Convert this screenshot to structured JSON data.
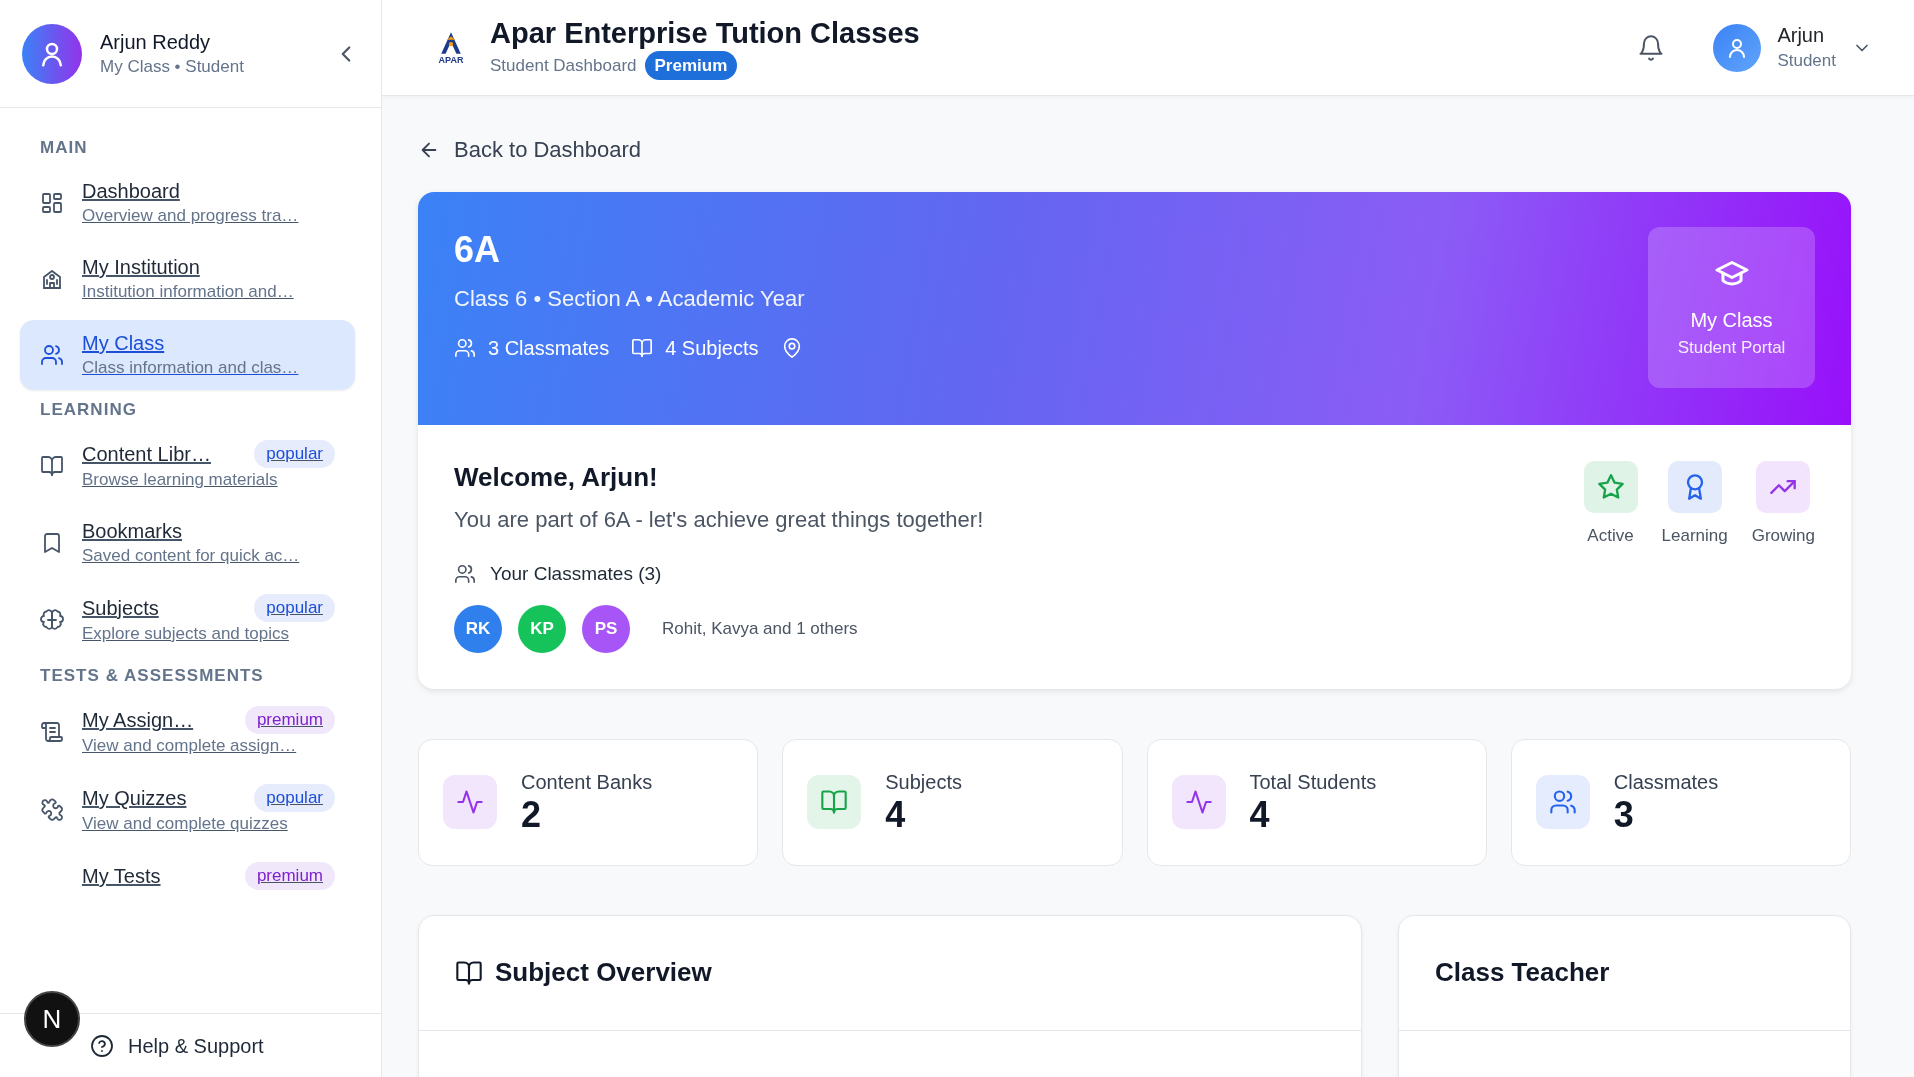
{
  "sidebar": {
    "user": {
      "name": "Arjun Reddy",
      "subtitle": "My Class • Student"
    },
    "sections": [
      {
        "label": "MAIN",
        "items": [
          {
            "kind": "grid",
            "title": "Dashboard",
            "description": "Overview and progress tra…",
            "selected": false
          },
          {
            "kind": "building",
            "title": "My Institution",
            "description": "Institution information and…",
            "selected": false
          },
          {
            "kind": "users",
            "title": "My Class",
            "description": "Class information and clas…",
            "selected": true
          }
        ]
      },
      {
        "label": "LEARNING",
        "items": [
          {
            "kind": "book",
            "title": "Content Libr…",
            "badge": {
              "label": "popular",
              "color": "#1d4ed8"
            },
            "description": "Browse learning materials",
            "selected": false
          },
          {
            "kind": "bookmark",
            "title": "Bookmarks",
            "description": "Saved content for quick ac…",
            "selected": false
          },
          {
            "kind": "brain",
            "title": "Subjects",
            "badge": {
              "label": "popular",
              "color": "#1d4ed8"
            },
            "description": "Explore subjects and topics",
            "selected": false
          }
        ]
      },
      {
        "label": "TESTS & ASSESSMENTS",
        "items": [
          {
            "kind": "scroll",
            "title": "My Assign…",
            "badge": {
              "label": "premium",
              "color": "#7e22ce"
            },
            "description": "View and complete assign…",
            "selected": false
          },
          {
            "kind": "puzzle",
            "title": "My Quizzes",
            "badge": {
              "label": "popular",
              "color": "#1d4ed8"
            },
            "description": "View and complete quizzes",
            "selected": false
          },
          {
            "title": "My Tests",
            "badge": {
              "label": "premium",
              "color": "#7e22ce"
            },
            "selected": false
          }
        ]
      }
    ],
    "footer": {
      "label": "Help & Support"
    }
  },
  "dev_badge": "N",
  "header": {
    "logo_text": "APAR",
    "title": "Apar Enterprise Tution Classes",
    "subtitle": "Student Dashboard",
    "plan_badge": "Premium",
    "user": {
      "name": "Arjun",
      "role": "Student"
    }
  },
  "back_link": "Back to Dashboard",
  "class_banner": {
    "title": "6A",
    "subtitle": "Class 6 • Section A • Academic Year",
    "meta": [
      {
        "kind": "users",
        "label": "3 Classmates"
      },
      {
        "kind": "book",
        "label": "4 Subjects"
      },
      {
        "kind": "pin"
      }
    ],
    "portal": {
      "title": "My Class",
      "subtitle": "Student Portal"
    }
  },
  "welcome": {
    "title": "Welcome, Arjun!",
    "message": "You are part of 6A - let's achieve great things together!",
    "classmates_heading": "Your Classmates (3)",
    "classmates": [
      {
        "initials": "RK",
        "color": "#2f80ed"
      },
      {
        "initials": "KP",
        "color": "#16c35b"
      },
      {
        "initials": "PS",
        "color": "#a855f7"
      }
    ],
    "classmates_summary": "Rohit, Kavya and 1 others",
    "achievements": [
      {
        "kind": "star",
        "label": "Active",
        "color": "#16a34a"
      },
      {
        "kind": "award",
        "label": "Learning",
        "color": "#2563eb"
      },
      {
        "kind": "trend",
        "label": "Growing",
        "color": "#9333ea"
      }
    ]
  },
  "stats": [
    {
      "kind": "activity",
      "label": "Content Banks",
      "value": "2",
      "color": "#9333ea"
    },
    {
      "kind": "book",
      "label": "Subjects",
      "value": "4",
      "color": "#16a34a"
    },
    {
      "kind": "activity",
      "label": "Total Students",
      "value": "4",
      "color": "#9333ea"
    },
    {
      "kind": "users",
      "label": "Classmates",
      "value": "3",
      "color": "#2563eb"
    }
  ],
  "panels": [
    {
      "kind": "book",
      "title": "Subject Overview"
    },
    {
      "title": "Class Teacher"
    }
  ]
}
